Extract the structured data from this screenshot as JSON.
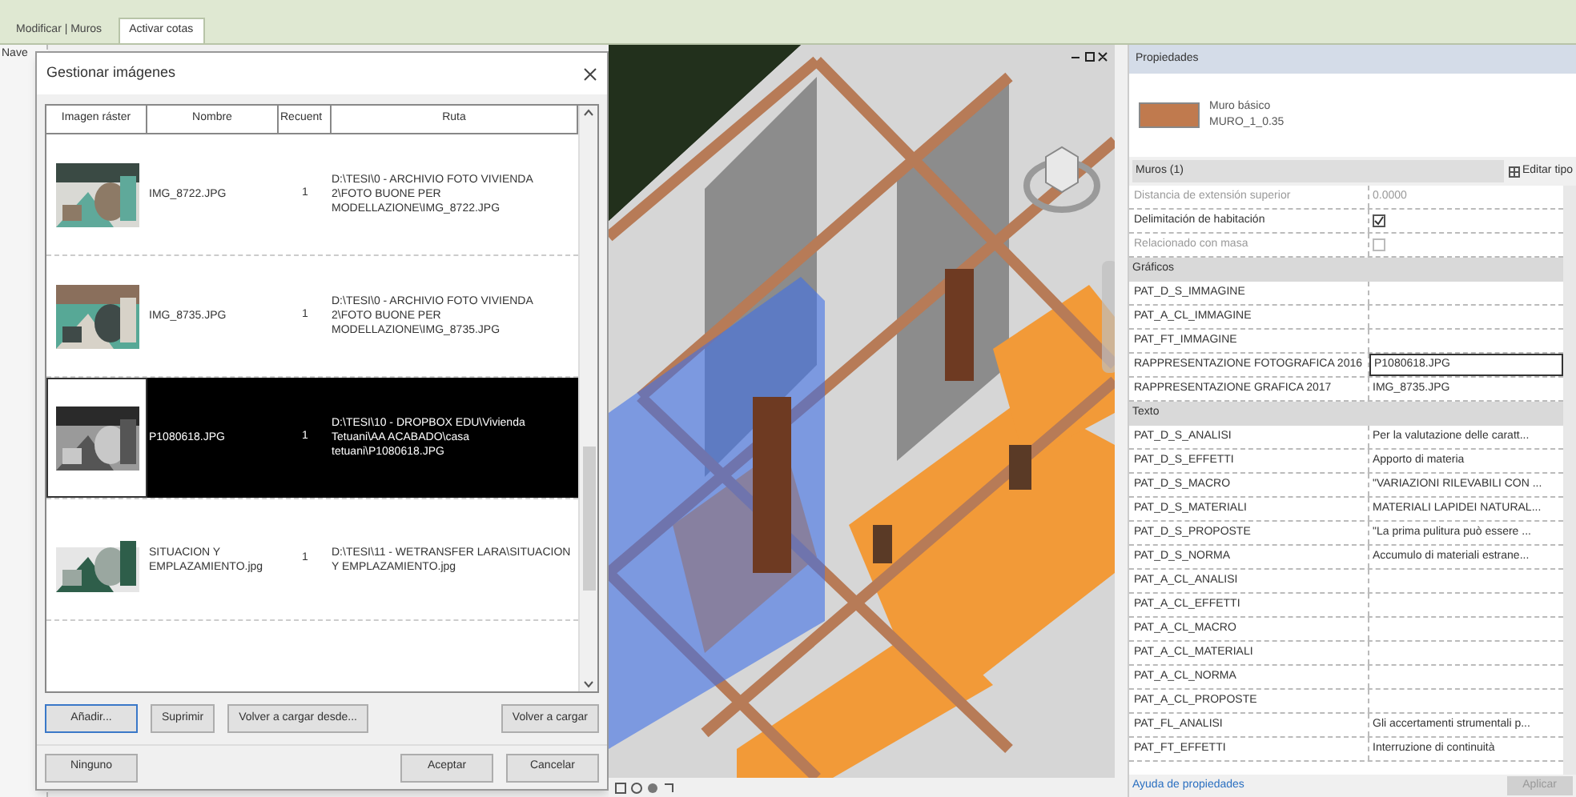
{
  "tabs": [
    {
      "label": "Modificar | Muros",
      "selected": false
    },
    {
      "label": "Activar cotas",
      "selected": true
    }
  ],
  "browser_panel": {
    "title": "Nave"
  },
  "dialog": {
    "title": "Gestionar imágenes",
    "columns": [
      "Imagen ráster",
      "Nombre",
      "Recuent",
      "Ruta"
    ],
    "rows": [
      {
        "name": "IMG_8722.JPG",
        "count": "1",
        "path": "D:\\TESI\\0 - ARCHIVIO FOTO VIVIENDA 2\\FOTO BUONE PER MODELLAZIONE\\IMG_8722.JPG",
        "selected": false
      },
      {
        "name": "IMG_8735.JPG",
        "count": "1",
        "path": "D:\\TESI\\0 - ARCHIVIO FOTO VIVIENDA 2\\FOTO BUONE PER MODELLAZIONE\\IMG_8735.JPG",
        "selected": false
      },
      {
        "name": "P1080618.JPG",
        "count": "1",
        "path": "D:\\TESI\\10 - DROPBOX EDU\\Vivienda Tetuani\\AA ACABADO\\casa tetuani\\P1080618.JPG",
        "selected": true
      },
      {
        "name": "SITUACION Y EMPLAZAMIENTO.jpg",
        "count": "1",
        "path": "D:\\TESI\\11 - WETRANSFER LARA\\SITUACION Y EMPLAZAMIENTO.jpg",
        "selected": false
      }
    ],
    "buttons": [
      {
        "label": "Añadir...",
        "default": true
      },
      {
        "label": "Suprimir",
        "default": false
      },
      {
        "label": "Volver a cargar desde...",
        "default": false
      },
      {
        "label": "Volver a cargar",
        "default": false
      }
    ],
    "footer_buttons": [
      "Ninguno",
      "Aceptar",
      "Cancelar"
    ]
  },
  "properties": {
    "title": "Propiedades",
    "type_name": "Muro básico",
    "type_id": "MURO_1_0.35",
    "instance_filter": "Muros (1)",
    "edit_type": "Editar tipo",
    "rows": [
      {
        "kind": "text",
        "name": "Distancia de extensión superior",
        "value": "0.0000",
        "disabled": true,
        "editing": false
      },
      {
        "kind": "check",
        "name": "Delimitación de habitación",
        "checked": true,
        "disabled": false
      },
      {
        "kind": "check",
        "name": "Relacionado con masa",
        "checked": false,
        "disabled": true
      },
      {
        "kind": "group",
        "name": "Gráficos"
      },
      {
        "kind": "text",
        "name": "PAT_D_S_IMMAGINE",
        "disabled": false,
        "editing": false
      },
      {
        "kind": "text",
        "name": "PAT_A_CL_IMMAGINE",
        "disabled": false,
        "editing": false
      },
      {
        "kind": "text",
        "name": "PAT_FT_IMMAGINE",
        "disabled": false,
        "editing": false
      },
      {
        "kind": "text",
        "name": "RAPPRESENTAZIONE FOTOGRAFICA 2016",
        "value": "P1080618.JPG",
        "disabled": false,
        "editing": true
      },
      {
        "kind": "text",
        "name": "RAPPRESENTAZIONE GRAFICA 2017",
        "value": "IMG_8735.JPG",
        "disabled": false,
        "editing": false
      },
      {
        "kind": "group",
        "name": "Texto"
      },
      {
        "kind": "text",
        "name": "PAT_D_S_ANALISI",
        "value": "Per la valutazione delle caratt...",
        "disabled": false,
        "editing": false
      },
      {
        "kind": "text",
        "name": "PAT_D_S_EFFETTI",
        "value": "Apporto di materia",
        "disabled": false,
        "editing": false
      },
      {
        "kind": "text",
        "name": "PAT_D_S_MACRO",
        "value": "\"VARIAZIONI RILEVABILI CON ...",
        "disabled": false,
        "editing": false
      },
      {
        "kind": "text",
        "name": "PAT_D_S_MATERIALI",
        "value": "MATERIALI LAPIDEI NATURAL...",
        "disabled": false,
        "editing": false
      },
      {
        "kind": "text",
        "name": "PAT_D_S_PROPOSTE",
        "value": "\"La prima pulitura può essere ...",
        "disabled": false,
        "editing": false
      },
      {
        "kind": "text",
        "name": "PAT_D_S_NORMA",
        "value": "Accumulo di materiali estrane...",
        "disabled": false,
        "editing": false
      },
      {
        "kind": "text",
        "name": "PAT_A_CL_ANALISI",
        "disabled": false,
        "editing": false
      },
      {
        "kind": "text",
        "name": "PAT_A_CL_EFFETTI",
        "disabled": false,
        "editing": false
      },
      {
        "kind": "text",
        "name": "PAT_A_CL_MACRO",
        "disabled": false,
        "editing": false
      },
      {
        "kind": "text",
        "name": "PAT_A_CL_MATERIALI",
        "disabled": false,
        "editing": false
      },
      {
        "kind": "text",
        "name": "PAT_A_CL_NORMA",
        "disabled": false,
        "editing": false
      },
      {
        "kind": "text",
        "name": "PAT_A_CL_PROPOSTE",
        "disabled": false,
        "editing": false
      },
      {
        "kind": "text",
        "name": "PAT_FL_ANALISI",
        "value": "Gli accertamenti strumentali p...",
        "disabled": false,
        "editing": false
      },
      {
        "kind": "text",
        "name": "PAT_FT_EFFETTI",
        "value": "Interruzione di continuità",
        "disabled": false,
        "editing": false
      }
    ],
    "help_link": "Ayuda de propiedades",
    "apply": {
      "label": "Aplicar",
      "disabled": true
    }
  }
}
